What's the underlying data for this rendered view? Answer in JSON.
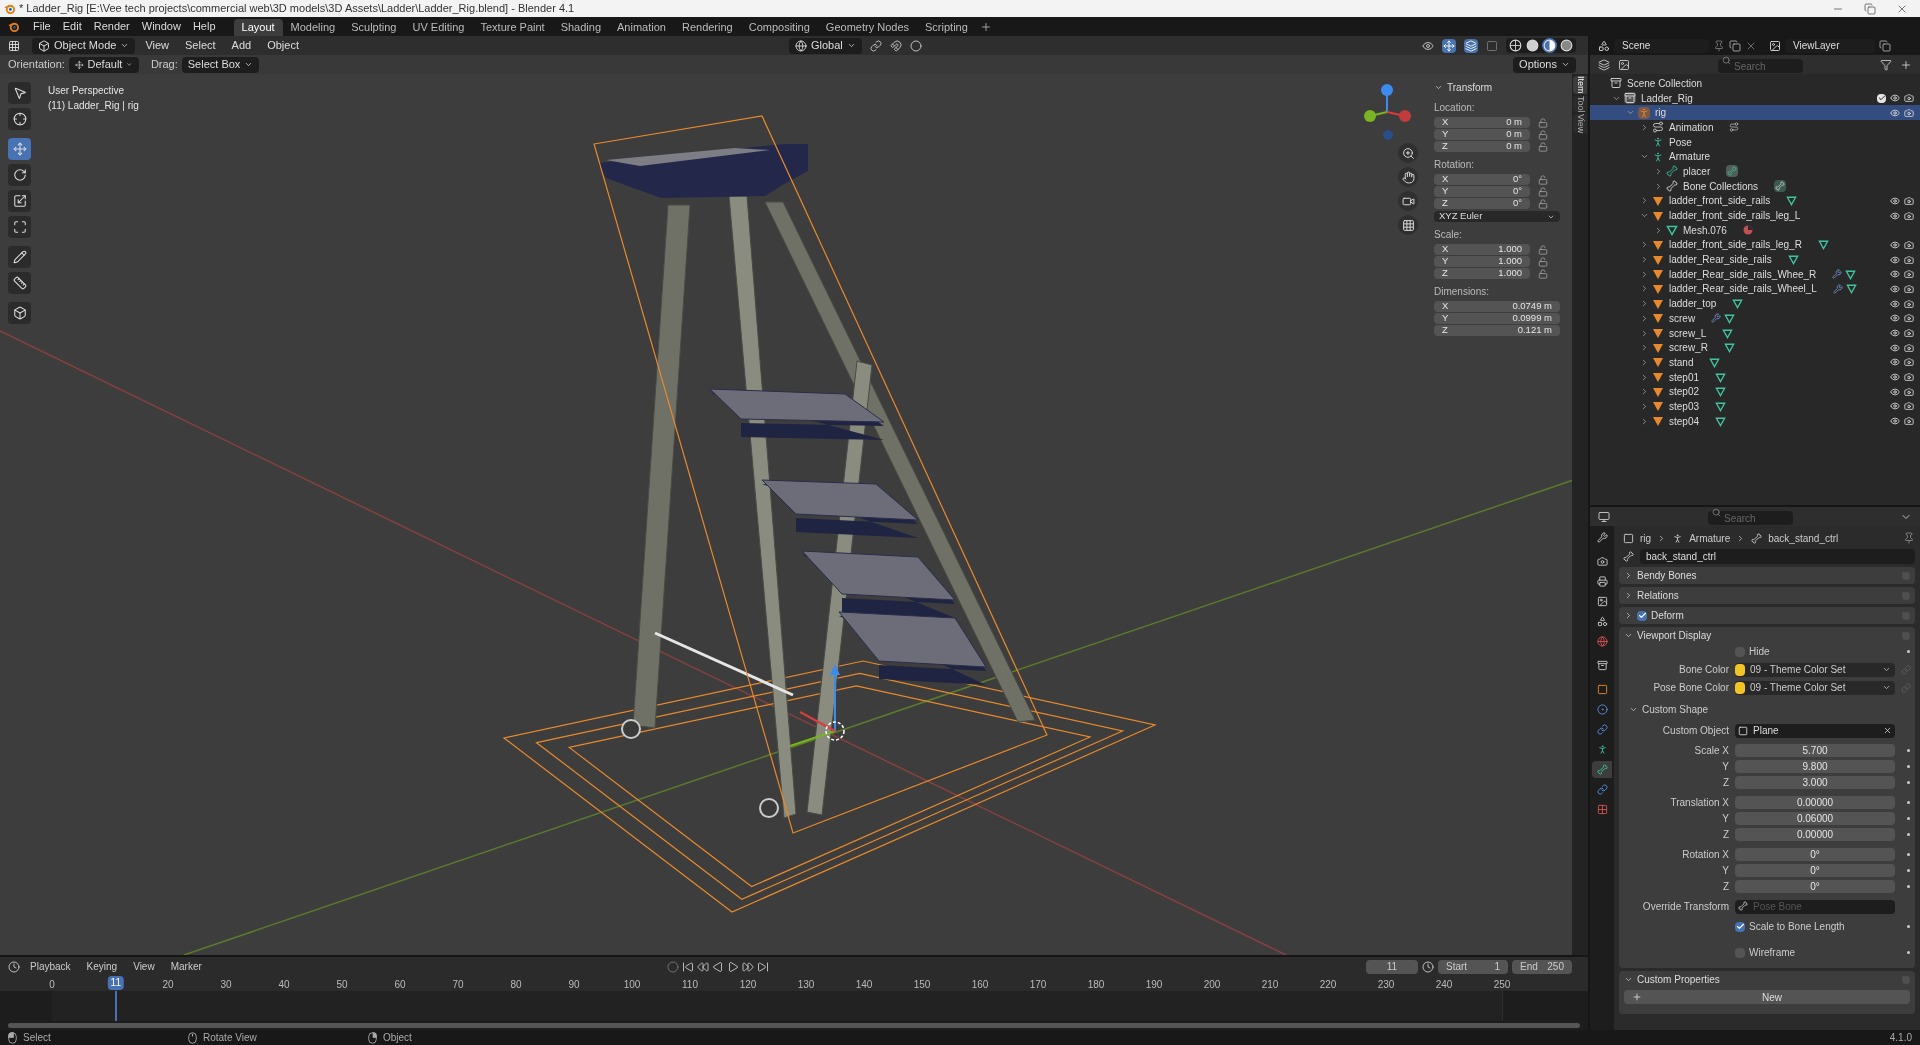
{
  "title_bar": {
    "title": "* Ladder_Rig [E:\\Vee tech projects\\commercial web\\3D models\\3D Assets\\Ladder\\Ladder_Rig.blend] - Blender 4.1"
  },
  "menu": [
    "File",
    "Edit",
    "Render",
    "Window",
    "Help"
  ],
  "workspaces": [
    {
      "label": "Layout",
      "selected": true
    },
    {
      "label": "Modeling",
      "selected": false
    },
    {
      "label": "Sculpting",
      "selected": false
    },
    {
      "label": "UV Editing",
      "selected": false
    },
    {
      "label": "Texture Paint",
      "selected": false
    },
    {
      "label": "Shading",
      "selected": false
    },
    {
      "label": "Animation",
      "selected": false
    },
    {
      "label": "Rendering",
      "selected": false
    },
    {
      "label": "Compositing",
      "selected": false
    },
    {
      "label": "Geometry Nodes",
      "selected": false
    },
    {
      "label": "Scripting",
      "selected": false
    }
  ],
  "viewport": {
    "mode": "Object Mode",
    "menus": [
      "View",
      "Select",
      "Add",
      "Object"
    ],
    "transform_orientation": "Global",
    "orientation_label": "Orientation:",
    "orientation": "Default",
    "drag_label": "Drag:",
    "drag": "Select Box",
    "options": "Options",
    "shading": [
      {
        "kind": "wireframe",
        "selected": false
      },
      {
        "kind": "solid",
        "selected": false
      },
      {
        "kind": "material",
        "selected": true
      },
      {
        "kind": "rendered",
        "selected": false
      }
    ],
    "view_name": "User Perspective",
    "object_info": "(11) Ladder_Rig | rig",
    "tools": [
      {
        "kind": "select",
        "selected": false
      },
      {
        "kind": "cursor",
        "selected": false
      },
      {
        "kind": "move",
        "selected": true
      },
      {
        "kind": "rotate",
        "selected": false
      },
      {
        "kind": "scale",
        "selected": false
      },
      {
        "kind": "transform",
        "selected": false
      },
      {
        "kind": "annotate",
        "selected": false
      },
      {
        "kind": "measure",
        "selected": false
      },
      {
        "kind": "add_cube",
        "selected": false
      }
    ],
    "side_tabs": [
      {
        "label": "Item",
        "selected": true
      },
      {
        "label": "Tool",
        "selected": false
      },
      {
        "label": "View",
        "selected": false
      }
    ],
    "transform": {
      "title": "Transform",
      "groups": [
        {
          "label": "Location:",
          "lockable": true,
          "rows": [
            {
              "axis": "X",
              "value": "0 m"
            },
            {
              "axis": "Y",
              "value": "0 m"
            },
            {
              "axis": "Z",
              "value": "0 m"
            }
          ]
        },
        {
          "label": "Rotation:",
          "lockable": true,
          "mode": "XYZ Euler",
          "rows": [
            {
              "axis": "X",
              "value": "0°"
            },
            {
              "axis": "Y",
              "value": "0°"
            },
            {
              "axis": "Z",
              "value": "0°"
            }
          ]
        },
        {
          "label": "Scale:",
          "lockable": true,
          "rows": [
            {
              "axis": "X",
              "value": "1.000"
            },
            {
              "axis": "Y",
              "value": "1.000"
            },
            {
              "axis": "Z",
              "value": "1.000"
            }
          ]
        },
        {
          "label": "Dimensions:",
          "lockable": false,
          "rows": [
            {
              "axis": "X",
              "value": "0.0749 m"
            },
            {
              "axis": "Y",
              "value": "0.0999 m"
            },
            {
              "axis": "Z",
              "value": "0.121 m"
            }
          ]
        }
      ]
    }
  },
  "outliner": {
    "scene": "Scene",
    "view_layer": "ViewLayer",
    "search_placeholder": "Search",
    "tree": [
      {
        "name": "Scene Collection",
        "kind": "scene_collection",
        "selected": false,
        "children": [
          {
            "name": "Ladder_Rig",
            "kind": "collection",
            "selected": false,
            "expanded": true,
            "checked": true,
            "visible": true,
            "children": [
              {
                "name": "rig",
                "kind": "armature_object",
                "selected": true,
                "expanded": true,
                "visible": true,
                "children": [
                  {
                    "name": "Animation",
                    "kind": "action",
                    "selected": false,
                    "expanded": false,
                    "badges": [
                      {
                        "kind": "action"
                      }
                    ]
                  },
                  {
                    "name": "Pose",
                    "kind": "pose",
                    "selected": false
                  },
                  {
                    "name": "Armature",
                    "kind": "armature_data",
                    "selected": false,
                    "expanded": true,
                    "children": [
                      {
                        "name": "placer",
                        "kind": "bone",
                        "selected": false,
                        "expanded": false,
                        "badges": [
                          {
                            "kind": "bone"
                          }
                        ]
                      },
                      {
                        "name": "Bone Collections",
                        "kind": "bone_collections",
                        "selected": false,
                        "expanded": false,
                        "badges": [
                          {
                            "kind": "bone_collections"
                          }
                        ]
                      }
                    ]
                  },
                  {
                    "name": "ladder_front_side_rails",
                    "kind": "mesh_object",
                    "selected": false,
                    "expanded": false,
                    "visible": true,
                    "badges": [
                      {
                        "kind": "mesh"
                      }
                    ]
                  },
                  {
                    "name": "ladder_front_side_rails_leg_L",
                    "kind": "mesh_object",
                    "selected": false,
                    "expanded": true,
                    "visible": true,
                    "children": [
                      {
                        "name": "Mesh.076",
                        "kind": "mesh_data",
                        "selected": false,
                        "expanded": false,
                        "badges": [
                          {
                            "kind": "material"
                          }
                        ]
                      }
                    ]
                  },
                  {
                    "name": "ladder_front_side_rails_leg_R",
                    "kind": "mesh_object",
                    "selected": false,
                    "expanded": false,
                    "visible": true,
                    "badges": [
                      {
                        "kind": "mesh"
                      }
                    ]
                  },
                  {
                    "name": "ladder_Rear_side_rails",
                    "kind": "mesh_object",
                    "selected": false,
                    "expanded": false,
                    "visible": true,
                    "badges": [
                      {
                        "kind": "mesh"
                      }
                    ]
                  },
                  {
                    "name": "ladder_Rear_side_rails_Whee_R",
                    "kind": "mesh_object",
                    "selected": false,
                    "expanded": false,
                    "visible": true,
                    "badges": [
                      {
                        "kind": "modifier"
                      },
                      {
                        "kind": "mesh"
                      }
                    ]
                  },
                  {
                    "name": "ladder_Rear_side_rails_Wheel_L",
                    "kind": "mesh_object",
                    "selected": false,
                    "expanded": false,
                    "visible": true,
                    "badges": [
                      {
                        "kind": "modifier"
                      },
                      {
                        "kind": "mesh"
                      }
                    ]
                  },
                  {
                    "name": "ladder_top",
                    "kind": "mesh_object",
                    "selected": false,
                    "expanded": false,
                    "visible": true,
                    "badges": [
                      {
                        "kind": "mesh"
                      }
                    ]
                  },
                  {
                    "name": "screw",
                    "kind": "mesh_object",
                    "selected": false,
                    "expanded": false,
                    "visible": true,
                    "badges": [
                      {
                        "kind": "modifier"
                      },
                      {
                        "kind": "mesh"
                      }
                    ]
                  },
                  {
                    "name": "screw_L",
                    "kind": "mesh_object",
                    "selected": false,
                    "expanded": false,
                    "visible": true,
                    "badges": [
                      {
                        "kind": "mesh"
                      }
                    ]
                  },
                  {
                    "name": "screw_R",
                    "kind": "mesh_object",
                    "selected": false,
                    "expanded": false,
                    "visible": true,
                    "badges": [
                      {
                        "kind": "mesh"
                      }
                    ]
                  },
                  {
                    "name": "stand",
                    "kind": "mesh_object",
                    "selected": false,
                    "expanded": false,
                    "visible": true,
                    "badges": [
                      {
                        "kind": "mesh"
                      }
                    ]
                  },
                  {
                    "name": "step01",
                    "kind": "mesh_object",
                    "selected": false,
                    "expanded": false,
                    "visible": true,
                    "badges": [
                      {
                        "kind": "mesh"
                      }
                    ]
                  },
                  {
                    "name": "step02",
                    "kind": "mesh_object",
                    "selected": false,
                    "expanded": false,
                    "visible": true,
                    "badges": [
                      {
                        "kind": "mesh"
                      }
                    ]
                  },
                  {
                    "name": "step03",
                    "kind": "mesh_object",
                    "selected": false,
                    "expanded": false,
                    "visible": true,
                    "badges": [
                      {
                        "kind": "mesh"
                      }
                    ]
                  },
                  {
                    "name": "step04",
                    "kind": "mesh_object",
                    "selected": false,
                    "expanded": false,
                    "visible": true,
                    "badges": [
                      {
                        "kind": "mesh"
                      }
                    ]
                  }
                ]
              }
            ]
          }
        ]
      }
    ]
  },
  "properties": {
    "search_placeholder": "Search",
    "tabs": [
      {
        "kind": "tool",
        "selected": false
      },
      {
        "kind": "render",
        "selected": false
      },
      {
        "kind": "output",
        "selected": false
      },
      {
        "kind": "view_layer",
        "selected": false
      },
      {
        "kind": "scene",
        "selected": false
      },
      {
        "kind": "world",
        "selected": false
      },
      {
        "kind": "collection",
        "selected": false
      },
      {
        "kind": "object",
        "selected": false
      },
      {
        "kind": "physics",
        "selected": false
      },
      {
        "kind": "constraints",
        "selected": false
      },
      {
        "kind": "data",
        "selected": false
      },
      {
        "kind": "bone",
        "selected": true
      },
      {
        "kind": "bone_constraints",
        "selected": false
      },
      {
        "kind": "texture",
        "selected": false
      }
    ],
    "breadcrumb": [
      {
        "kind": "object",
        "label": "rig"
      },
      {
        "kind": "armature",
        "label": "Armature"
      },
      {
        "kind": "bone",
        "label": "back_stand_ctrl"
      }
    ],
    "bone_name": "back_stand_ctrl",
    "panels": [
      {
        "title": "Bendy Bones",
        "expanded": false
      },
      {
        "title": "Relations",
        "expanded": false
      },
      {
        "title": "Deform",
        "expanded": false,
        "checked": true
      },
      {
        "title": "Viewport Display",
        "kind": "viewport_display",
        "expanded": true
      },
      {
        "title": "Custom Properties",
        "kind": "custom_properties",
        "expanded": true
      }
    ],
    "viewport_display": {
      "hide": {
        "label": "Hide",
        "checked": false
      },
      "colors": [
        {
          "label": "Bone Color",
          "value": "09 - Theme Color Set"
        },
        {
          "label": "Pose Bone Color",
          "value": "09 - Theme Color Set"
        }
      ],
      "custom_shape": {
        "title": "Custom Shape",
        "expanded": true,
        "object_label": "Custom Object",
        "object": "Plane",
        "groups": [
          [
            {
              "label": "Scale X",
              "value": "5.700"
            },
            {
              "label": "Y",
              "value": "9.800"
            },
            {
              "label": "Z",
              "value": "3.000"
            }
          ],
          [
            {
              "label": "Translation X",
              "value": "0.00000"
            },
            {
              "label": "Y",
              "value": "0.06000"
            },
            {
              "label": "Z",
              "value": "0.00000"
            }
          ],
          [
            {
              "label": "Rotation X",
              "value": "0°"
            },
            {
              "label": "Y",
              "value": "0°"
            },
            {
              "label": "Z",
              "value": "0°"
            }
          ]
        ],
        "override_label": "Override Transform",
        "override_placeholder": "Pose Bone",
        "options": [
          {
            "label": "Scale to Bone Length",
            "checked": true
          },
          {
            "label": "Wireframe",
            "checked": false
          }
        ]
      }
    },
    "custom_properties": {
      "new_button": "New"
    }
  },
  "timeline": {
    "menus": [
      "Playback",
      "Keying",
      "View",
      "Marker"
    ],
    "current_frame": "11",
    "start_label": "Start",
    "start": "1",
    "end_label": "End",
    "end": "250",
    "ticks": [
      "0",
      "20",
      "30",
      "40",
      "50",
      "60",
      "70",
      "80",
      "90",
      "100",
      "110",
      "120",
      "130",
      "140",
      "150",
      "160",
      "170",
      "180",
      "190",
      "200",
      "210",
      "220",
      "230",
      "240",
      "250"
    ],
    "playhead": {
      "label": "11",
      "level": 0.044
    }
  },
  "status_bar": {
    "hints": [
      {
        "kind": "left_mouse",
        "label": "Select"
      },
      {
        "kind": "middle_mouse",
        "label": "Rotate View"
      },
      {
        "kind": "right_mouse",
        "label": "Object"
      }
    ],
    "version": "4.1.0"
  }
}
